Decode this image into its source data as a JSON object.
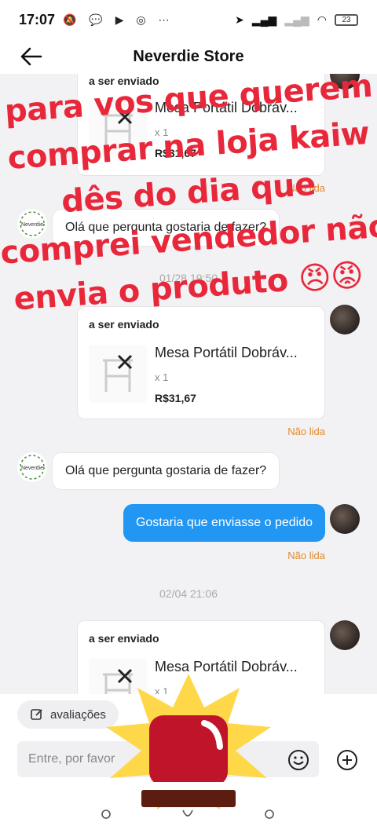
{
  "status_bar": {
    "time": "17:07",
    "battery": "23",
    "notification_icons": [
      "silent-mode-icon",
      "chat-icon",
      "youtube-icon",
      "compass-icon",
      "more-dots-icon"
    ]
  },
  "header": {
    "title": "Neverdie Store"
  },
  "messages": [
    {
      "type": "order",
      "status": "a ser enviado",
      "product": "Mesa Portátil Dobráv...",
      "qty": "x 1",
      "price": "R$31,67",
      "read_state": "Não lida"
    },
    {
      "type": "incoming",
      "text": "Olá que pergunta gostaria de fazer?"
    },
    {
      "type": "timestamp",
      "text": "01/28 19:50"
    },
    {
      "type": "order",
      "status": "a ser enviado",
      "product": "Mesa Portátil Dobráv...",
      "qty": "x 1",
      "price": "R$31,67",
      "read_state": "Não lida"
    },
    {
      "type": "incoming",
      "text": "Olá que pergunta gostaria de fazer?"
    },
    {
      "type": "outgoing",
      "text": "Gostaria que enviasse o pedido",
      "read_state": "Não lida"
    },
    {
      "type": "timestamp",
      "text": "02/04 21:06"
    },
    {
      "type": "order",
      "status": "a ser enviado",
      "product": "Mesa Portátil Dobráv...",
      "qty": "x 1"
    }
  ],
  "overlay": {
    "lines": [
      "para vos que querem",
      "comprar na loja kaiw",
      "dês do dia que",
      "comprei vendedor não",
      "envia o produto 😠😡"
    ],
    "color": "#e8283a"
  },
  "seller_logo_text": "Neverdie",
  "bottom": {
    "reviews_label": "avaliações",
    "input_placeholder": "Entre, por favor"
  },
  "colors": {
    "accent": "#2196f3",
    "unread": "#e08a2e",
    "overlay_text": "#e8283a"
  }
}
